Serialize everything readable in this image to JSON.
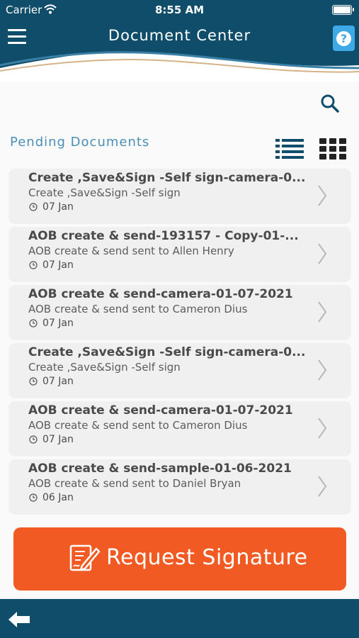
{
  "status_bar": {
    "carrier": "Carrier",
    "time": "8:55 AM"
  },
  "header": {
    "title": "Document Center"
  },
  "colors": {
    "header_bg": "#0f4d6a",
    "accent_orange": "#f15a22",
    "section_title": "#4b8fb5",
    "help_blue": "#3fa9e6"
  },
  "icons": {
    "menu": "hamburger-icon",
    "help": "question-icon",
    "search": "search-icon",
    "list_view": "list-view-icon",
    "grid_view": "grid-view-icon",
    "date": "clock-icon",
    "row_action": "chevron-right-icon",
    "request": "sign-document-icon",
    "back": "back-arrow-icon"
  },
  "section": {
    "title": "Pending Documents"
  },
  "documents": [
    {
      "title": "Create ,Save&Sign -Self sign-camera-0...",
      "subtitle": "Create ,Save&Sign -Self sign",
      "date": "07 Jan"
    },
    {
      "title": "AOB create & send-193157 - Copy-01-...",
      "subtitle": "AOB create & send sent to Allen Henry",
      "date": "07 Jan"
    },
    {
      "title": "AOB create & send-camera-01-07-2021",
      "subtitle": "AOB create & send sent to Cameron Dius",
      "date": "07 Jan"
    },
    {
      "title": "Create ,Save&Sign -Self sign-camera-0...",
      "subtitle": "Create ,Save&Sign -Self sign",
      "date": "07 Jan"
    },
    {
      "title": "AOB create & send-camera-01-07-2021",
      "subtitle": "AOB create & send sent to Cameron Dius",
      "date": "07 Jan"
    },
    {
      "title": "AOB create & send-sample-01-06-2021",
      "subtitle": "AOB create & send sent to  Daniel Bryan",
      "date": "06 Jan"
    }
  ],
  "actions": {
    "request_signature": "Request Signature"
  }
}
